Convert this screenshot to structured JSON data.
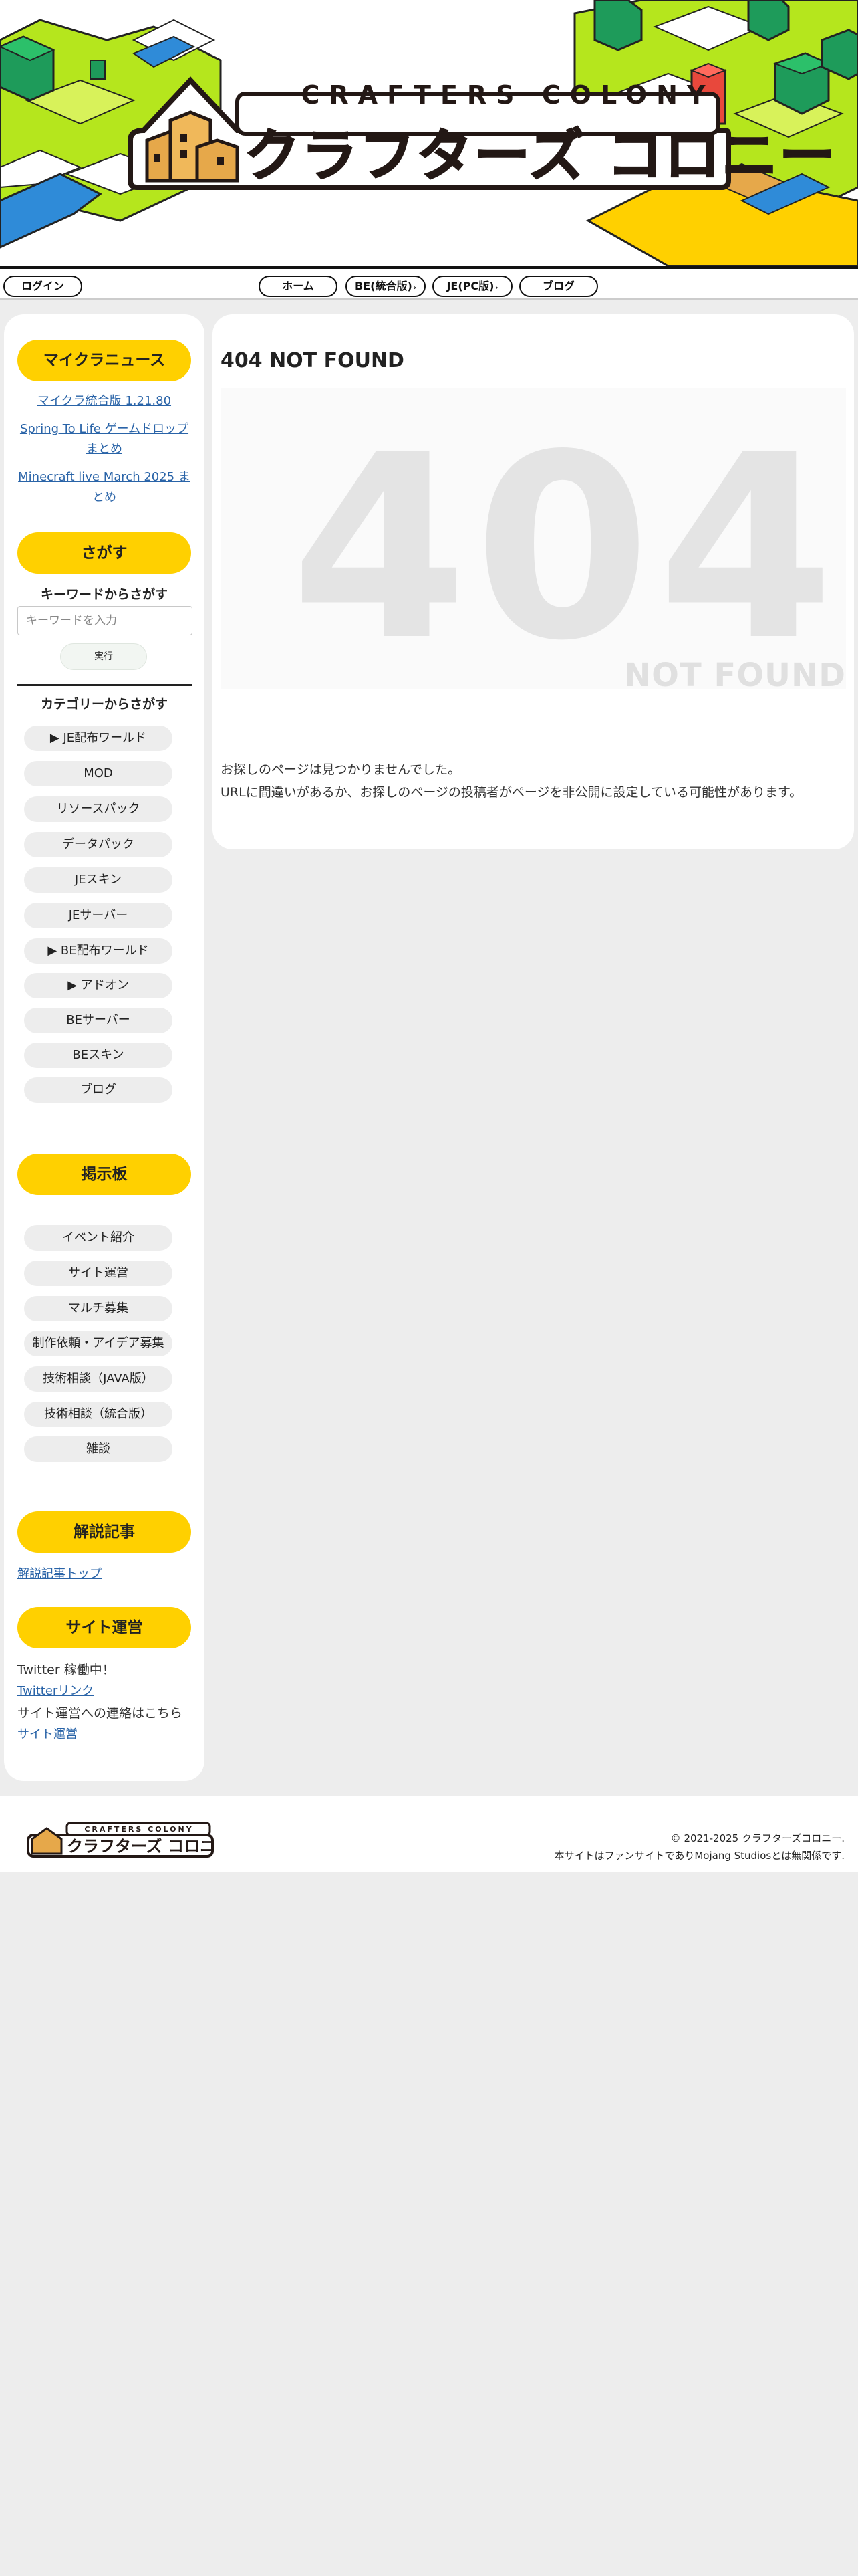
{
  "logo": {
    "en": "CRAFTERS COLONY",
    "jp": "クラフターズ コロニー"
  },
  "nav": {
    "login": "ログイン",
    "home": "ホーム",
    "be": "BE(統合版)",
    "je": "JE(PC版)",
    "blog": "ブログ"
  },
  "sidebar": {
    "news_heading": "マイクラニュース",
    "news": [
      "マイクラ統合版 1.21.80",
      "Spring To Life ゲームドロップ",
      "まとめ",
      "Minecraft live March 2025 ま",
      "とめ"
    ],
    "search_heading": "さがす",
    "keyword_label": "キーワードからさがす",
    "keyword_placeholder": "キーワードを入力",
    "exec_label": "実行",
    "category_label": "カテゴリーからさがす",
    "categories": [
      "▶ JE配布ワールド",
      "MOD",
      "リソースパック",
      "データパック",
      "JEスキン",
      "JEサーバー",
      "▶ BE配布ワールド",
      "▶ アドオン",
      "BEサーバー",
      "BEスキン",
      "ブログ"
    ],
    "board_heading": "掲示板",
    "board": [
      "イベント紹介",
      "サイト運営",
      "マルチ募集",
      "制作依頼・アイデア募集",
      "技術相談（JAVA版）",
      "技術相談（統合版）",
      "雑談"
    ],
    "articles_heading": "解説記事",
    "articles_link": "解説記事トップ",
    "site_heading": "サイト運営",
    "twitter_text": "Twitter 稼働中！",
    "twitter_link": "Twitterリンク",
    "contact_text": "サイト運営への連絡はこちら",
    "contact_link": "サイト運営"
  },
  "main": {
    "title": "404 NOT FOUND",
    "big_number": "404",
    "big_label": "NOT FOUND",
    "message1": "お探しのページは見つかりませんでした。",
    "message2": "URLに間違いがあるか、お探しのページの投稿者がページを非公開に設定している可能性があります。"
  },
  "footer": {
    "copyright": "© 2021-2025 クラフターズコロニー.",
    "disclaimer": "本サイトはファンサイトでありMojang Studiosとは無関係です."
  },
  "colors": {
    "accent": "#ffd000",
    "grass": "#b5e61d",
    "water": "#2f8bd8",
    "link": "#2a64a8",
    "background": "#ededed"
  }
}
